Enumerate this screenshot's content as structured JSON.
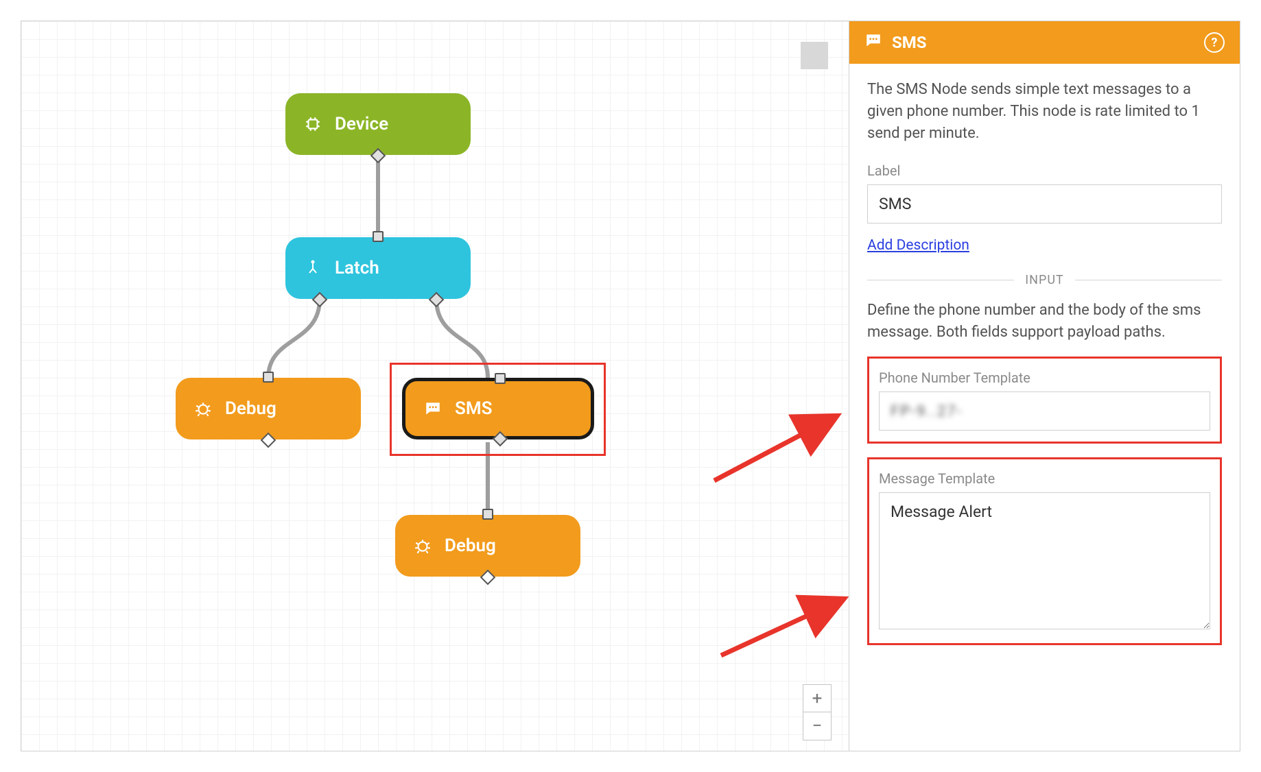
{
  "canvas": {
    "nodes": {
      "device": {
        "label": "Device"
      },
      "latch": {
        "label": "Latch"
      },
      "debug1": {
        "label": "Debug"
      },
      "sms": {
        "label": "SMS"
      },
      "debug2": {
        "label": "Debug"
      }
    },
    "zoom_in": "+",
    "zoom_out": "−"
  },
  "panel": {
    "title": "SMS",
    "help_glyph": "?",
    "description": "The SMS Node sends simple text messages to a given phone number. This node is rate limited to 1 send per minute.",
    "label_field_label": "Label",
    "label_value": "SMS",
    "add_description_link": "Add Description",
    "input_heading": "INPUT",
    "input_description": "Define the phone number and the body of the sms message. Both fields support payload paths.",
    "phone_label": "Phone Number Template",
    "phone_value_obscured": "FP-9..27-",
    "message_label": "Message Template",
    "message_value": "Message Alert"
  }
}
